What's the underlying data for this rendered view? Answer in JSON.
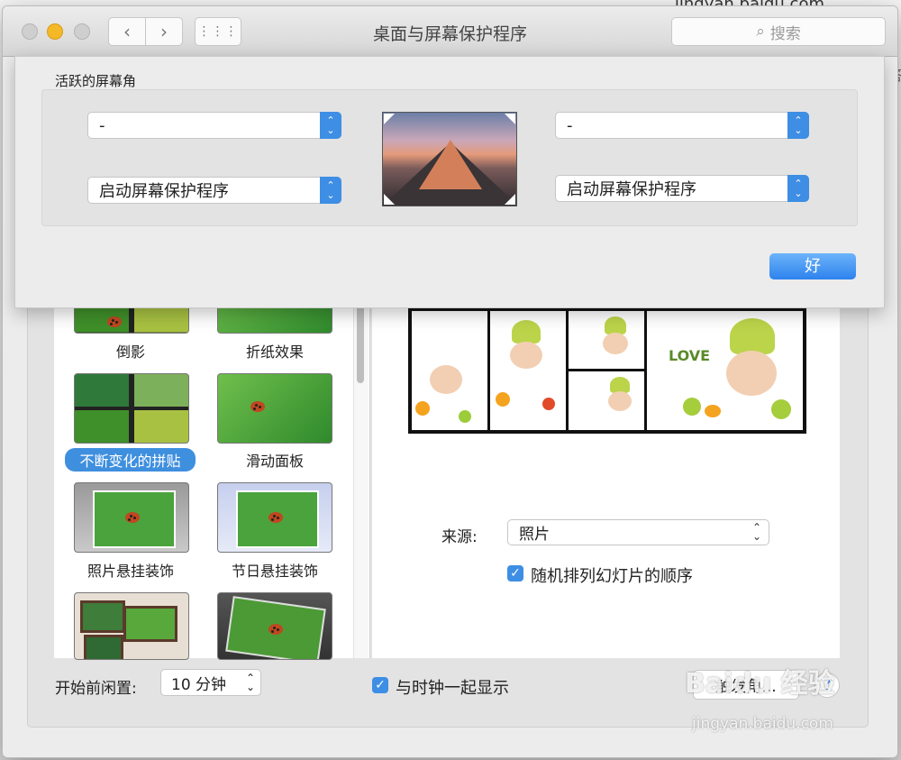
{
  "background": {
    "url_fragment": "jingyan.baidu.com",
    "edge_char": "答"
  },
  "window": {
    "title": "桌面与屏幕保护程序",
    "search_placeholder": "搜索"
  },
  "sheet": {
    "group_title": "活跃的屏幕角",
    "top_left_value": "-",
    "top_right_value": "-",
    "bottom_left_value": "启动屏幕保护程序",
    "bottom_right_value": "启动屏幕保护程序",
    "ok_label": "好"
  },
  "screensavers": [
    {
      "label": "倒影"
    },
    {
      "label": "折纸效果"
    },
    {
      "label": "不断变化的拼贴",
      "selected": true
    },
    {
      "label": "滑动面板"
    },
    {
      "label": "照片悬挂装饰"
    },
    {
      "label": "节日悬挂装饰"
    }
  ],
  "preview": {
    "source_label": "来源:",
    "source_value": "照片",
    "shuffle_label": "随机排列幻灯片的顺序",
    "shuffle_checked": true,
    "collage_text": "LOVE"
  },
  "bottom": {
    "idle_label": "开始前闲置:",
    "idle_value": "10 分钟",
    "show_clock_label": "与时钟一起显示",
    "show_clock_checked": true,
    "hot_corners_label": "触发角...",
    "help_label": "?"
  },
  "watermark": {
    "brand": "Baidu 经验",
    "url": "jingyan.baidu.com"
  },
  "colors": {
    "accent": "#3d8ee4",
    "window_bg": "#ececec"
  }
}
